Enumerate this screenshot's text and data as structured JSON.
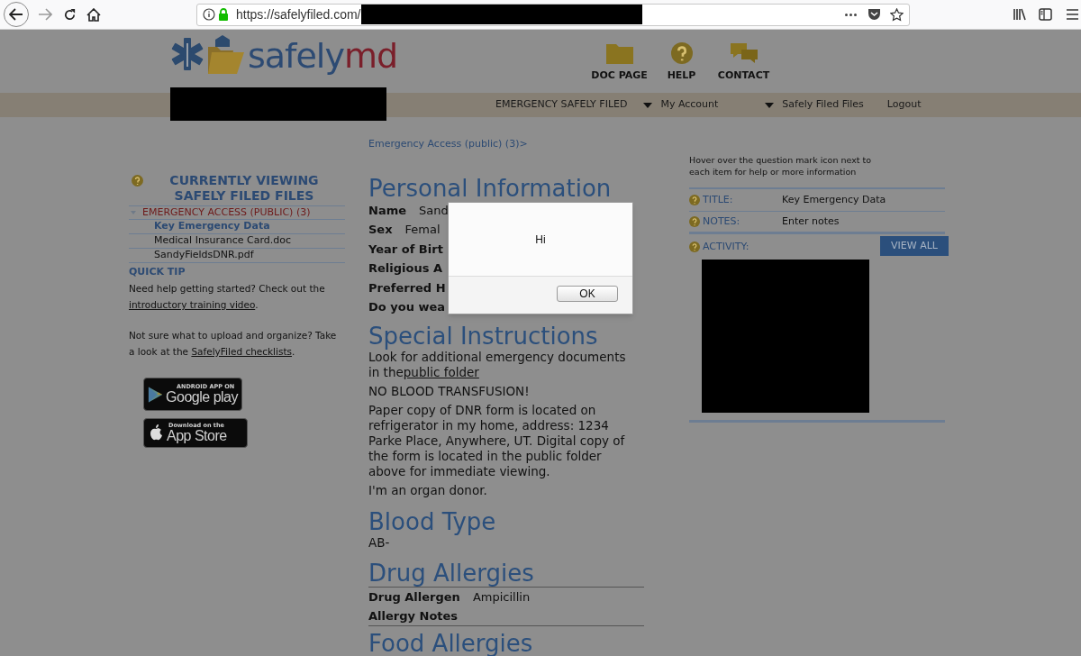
{
  "browser": {
    "url": "https://safelyfiled.com/"
  },
  "header": {
    "logo": {
      "part_1": "safely",
      "part_2": "md"
    },
    "nav": [
      {
        "label": "DOC PAGE",
        "kind": "folder"
      },
      {
        "label": "HELP",
        "kind": "help"
      },
      {
        "label": "CONTACT",
        "kind": "chat"
      }
    ]
  },
  "menu": [
    {
      "label": "EMERGENCY SAFELY FILED",
      "dropdown": false
    },
    {
      "label": "My Account",
      "dropdown": true
    },
    {
      "label": "Safely Filed Files",
      "dropdown": true
    },
    {
      "label": "Logout",
      "dropdown": false
    }
  ],
  "sidebar": {
    "title": "CURRENTLY VIEWING SAFELY FILED FILES",
    "folder": {
      "label": "EMERGENCY ACCESS (PUBLIC) (3)",
      "expanded": true,
      "children": [
        {
          "label": "Key Emergency Data",
          "selected": true
        },
        {
          "label": "Medical Insurance Card.doc",
          "selected": false
        },
        {
          "label": "SandyFieldsDNR.pdf",
          "selected": false
        }
      ]
    },
    "quick_tip_title": "QUICK TIP",
    "tips": [
      {
        "text": "Need help getting started? Check out the ",
        "link": "introductory training video",
        "end": "."
      },
      {
        "text": "Not sure what to upload and organize? Take a look at the ",
        "link": "SafelyFiled checklists",
        "end": "."
      }
    ],
    "badges": [
      {
        "kind": "google_play",
        "small": "ANDROID APP ON",
        "big": "Google play"
      },
      {
        "kind": "app_store",
        "small": "Download on the",
        "big": "App Store"
      }
    ]
  },
  "main": {
    "breadcrumb": "Emergency Access (public) (3)>",
    "personal": {
      "heading": "Personal Information",
      "rows": [
        {
          "label": "Name",
          "value": "Sand"
        },
        {
          "label": "Sex",
          "value": "Femal"
        },
        {
          "label": "Year of Birt"
        },
        {
          "label": "Religious A"
        },
        {
          "label": "Preferred H"
        },
        {
          "label": "Do you wea"
        }
      ]
    },
    "special": {
      "heading": "Special Instructions",
      "paragraphs": [
        {
          "text": "Look for additional emergency documents in the",
          "link": "public folder"
        },
        {
          "text": "NO BLOOD TRANSFUSION!"
        },
        {
          "text": "Paper copy of DNR form is located on refrigerator in my home, address: 1234 Parke Place, Anywhere, UT. Digital copy of the form is located in the public folder above for immediate viewing."
        },
        {
          "text": "I'm an organ donor."
        }
      ]
    },
    "blood": {
      "heading": "Blood Type",
      "value": "AB-"
    },
    "drug": {
      "heading": "Drug Allergies",
      "rows": [
        {
          "label": "Drug Allergen",
          "value": "Ampicillin"
        },
        {
          "label": "Allergy Notes"
        }
      ]
    },
    "food": {
      "heading": "Food Allergies"
    }
  },
  "details": {
    "hint": "Hover over the question mark icon next to each item for help or more information",
    "fields": [
      {
        "label": "TITLE:",
        "value": "Key Emergency Data"
      },
      {
        "label": "NOTES:",
        "value": "Enter notes"
      }
    ],
    "activity_label": "ACTIVITY:",
    "view_all": "VIEW ALL"
  },
  "dialog": {
    "message": "Hi",
    "button": "OK"
  }
}
